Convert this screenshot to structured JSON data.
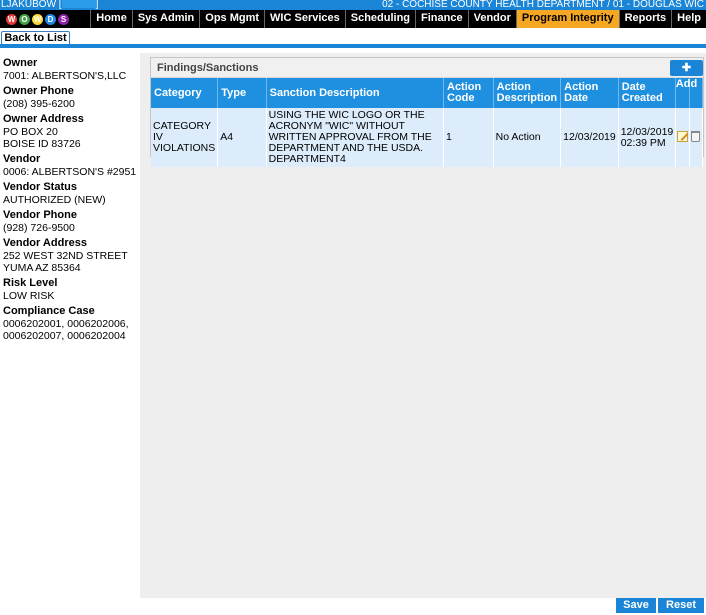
{
  "header": {
    "user": "LJAKUBOW",
    "location": "02 - COCHISE COUNTY HEALTH DEPARTMENT / 01 - DOUGLAS WIC"
  },
  "logo": {
    "letters": [
      "W",
      "O",
      "W",
      "D",
      "S"
    ]
  },
  "nav": {
    "items": [
      "Home",
      "Sys Admin",
      "Ops Mgmt",
      "WIC Services",
      "Scheduling",
      "Finance",
      "Vendor",
      "Program Integrity",
      "Reports",
      "Help"
    ],
    "active": "Program Integrity"
  },
  "back_button": "Back to List",
  "vendor_info": [
    {
      "label": "Owner",
      "lines": [
        "7001: ALBERTSON'S,LLC"
      ]
    },
    {
      "label": "Owner Phone",
      "lines": [
        "(208) 395-6200"
      ]
    },
    {
      "label": "Owner Address",
      "lines": [
        "PO BOX 20",
        "BOISE ID 83726"
      ]
    },
    {
      "label": "Vendor",
      "lines": [
        "0006: ALBERTSON'S #2951"
      ]
    },
    {
      "label": "Vendor Status",
      "lines": [
        "AUTHORIZED (NEW)"
      ]
    },
    {
      "label": "Vendor Phone",
      "lines": [
        "(928) 726-9500"
      ]
    },
    {
      "label": "Vendor Address",
      "lines": [
        "252 WEST 32ND STREET",
        "YUMA AZ 85364"
      ]
    },
    {
      "label": "Risk Level",
      "lines": [
        "LOW RISK"
      ]
    },
    {
      "label": "Compliance Case",
      "lines": [
        "0006202001, 0006202006,",
        "0006202007, 0006202004"
      ]
    }
  ],
  "findings": {
    "title": "Findings/Sanctions",
    "add_label": "Add",
    "columns": [
      "Category",
      "Type",
      "Sanction Description",
      "Action Code",
      "Action Description",
      "Action Date",
      "Date Created"
    ],
    "rows": [
      {
        "category": "CATEGORY IV VIOLATIONS",
        "type": "A4",
        "description": "USING THE WIC LOGO OR THE ACRONYM \"WIC\" WITHOUT WRITTEN APPROVAL FROM THE DEPARTMENT AND THE USDA. DEPARTMENT4",
        "action_code": "1",
        "action_description": "No Action",
        "action_date": "12/03/2019",
        "date_created": "12/03/2019 02:39 PM"
      }
    ]
  },
  "footer": {
    "save": "Save",
    "reset": "Reset"
  },
  "colors": {
    "accent": "#1a84d6",
    "nav_bg": "#000000",
    "active_tab": "#f5a623",
    "row_bg": "#dcecfb"
  }
}
